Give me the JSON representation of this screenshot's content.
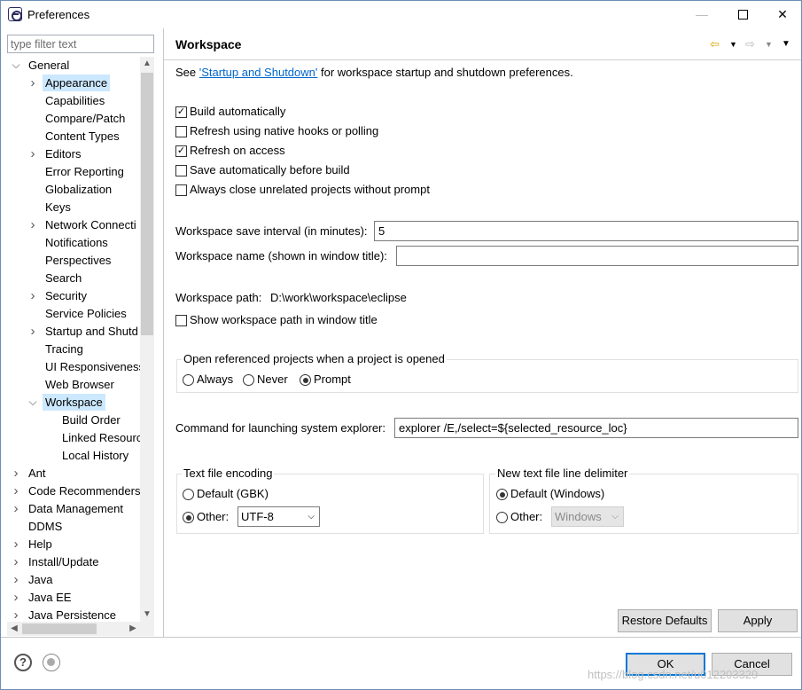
{
  "window": {
    "title": "Preferences",
    "minimize": "—",
    "close": "✕"
  },
  "filter": {
    "placeholder": "type filter text"
  },
  "tree": {
    "items": [
      {
        "label": "General",
        "chevron": "expanded",
        "level": 0
      },
      {
        "label": "Appearance",
        "chevron": "collapsed",
        "level": 1,
        "highlight": true
      },
      {
        "label": "Capabilities",
        "level": 1
      },
      {
        "label": "Compare/Patch",
        "level": 1
      },
      {
        "label": "Content Types",
        "level": 1
      },
      {
        "label": "Editors",
        "chevron": "collapsed",
        "level": 1
      },
      {
        "label": "Error Reporting",
        "level": 1
      },
      {
        "label": "Globalization",
        "level": 1
      },
      {
        "label": "Keys",
        "level": 1
      },
      {
        "label": "Network Connecti",
        "chevron": "collapsed",
        "level": 1
      },
      {
        "label": "Notifications",
        "level": 1
      },
      {
        "label": "Perspectives",
        "level": 1
      },
      {
        "label": "Search",
        "level": 1
      },
      {
        "label": "Security",
        "chevron": "collapsed",
        "level": 1
      },
      {
        "label": "Service Policies",
        "level": 1
      },
      {
        "label": "Startup and Shutd",
        "chevron": "collapsed",
        "level": 1
      },
      {
        "label": "Tracing",
        "level": 1
      },
      {
        "label": "UI Responsiveness",
        "level": 1
      },
      {
        "label": "Web Browser",
        "level": 1
      },
      {
        "label": "Workspace",
        "chevron": "expanded",
        "level": 1,
        "selected": true
      },
      {
        "label": "Build Order",
        "level": 2
      },
      {
        "label": "Linked Resourc",
        "level": 2
      },
      {
        "label": "Local History",
        "level": 2
      },
      {
        "label": "Ant",
        "chevron": "collapsed",
        "level": 0
      },
      {
        "label": "Code Recommenders",
        "chevron": "collapsed",
        "level": 0
      },
      {
        "label": "Data Management",
        "chevron": "collapsed",
        "level": 0
      },
      {
        "label": "DDMS",
        "level": 0
      },
      {
        "label": "Help",
        "chevron": "collapsed",
        "level": 0
      },
      {
        "label": "Install/Update",
        "chevron": "collapsed",
        "level": 0
      },
      {
        "label": "Java",
        "chevron": "collapsed",
        "level": 0
      },
      {
        "label": "Java EE",
        "chevron": "collapsed",
        "level": 0
      },
      {
        "label": "Java Persistence",
        "chevron": "collapsed",
        "level": 0
      }
    ]
  },
  "page": {
    "title": "Workspace",
    "desc_pre": "See ",
    "desc_link": "'Startup and Shutdown'",
    "desc_post": " for workspace startup and shutdown preferences.",
    "checkboxes": [
      {
        "id": "build-auto",
        "label": "Build automatically",
        "checked": true
      },
      {
        "id": "refresh-native",
        "label": "Refresh using native hooks or polling",
        "checked": false
      },
      {
        "id": "refresh-access",
        "label": "Refresh on access",
        "checked": true
      },
      {
        "id": "save-before-build",
        "label": "Save automatically before build",
        "checked": false
      },
      {
        "id": "close-unrelated",
        "label": "Always close unrelated projects without prompt",
        "checked": false
      }
    ],
    "save_interval_label": "Workspace save interval (in minutes):",
    "save_interval_value": "5",
    "workspace_name_label": "Workspace name (shown in window title):",
    "workspace_name_value": "",
    "workspace_path_label": "Workspace path:",
    "workspace_path_value": "D:\\work\\workspace\\eclipse",
    "show_path_label": "Show workspace path in window title",
    "open_ref_group": {
      "title": "Open referenced projects when a project is opened",
      "options": [
        "Always",
        "Never",
        "Prompt"
      ],
      "selected": "Prompt"
    },
    "explorer_label": "Command for launching system explorer:",
    "explorer_value": "explorer /E,/select=${selected_resource_loc}",
    "encoding_group": {
      "title": "Text file encoding",
      "default_label": "Default (GBK)",
      "other_label": "Other:",
      "other_value": "UTF-8",
      "selected": "Other"
    },
    "delimiter_group": {
      "title": "New text file line delimiter",
      "default_label": "Default (Windows)",
      "other_label": "Other:",
      "other_value": "Windows",
      "selected": "Default"
    },
    "restore_defaults": "Restore Defaults",
    "apply": "Apply"
  },
  "footer": {
    "ok": "OK",
    "cancel": "Cancel"
  },
  "watermark": "https://blog.csdn.net/u012203329"
}
